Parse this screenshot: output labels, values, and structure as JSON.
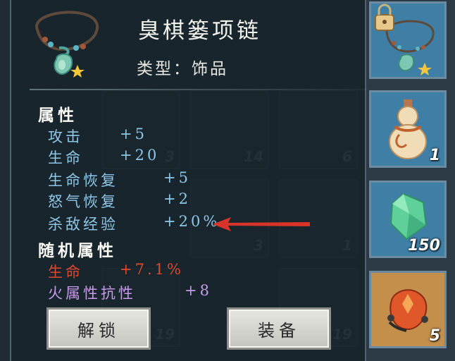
{
  "item": {
    "name": "臭棋篓项链",
    "type_label": "类型",
    "type_separator": "：",
    "type_value": "饰品"
  },
  "attributes": {
    "title": "属性",
    "stats": [
      {
        "name": "攻击",
        "value": "+5"
      },
      {
        "name": "生命",
        "value": "+20"
      },
      {
        "name": "生命恢复",
        "value": "+5"
      },
      {
        "name": "怒气恢复",
        "value": "+2"
      },
      {
        "name": "杀敌经验",
        "value": "+20%"
      }
    ]
  },
  "random_attributes": {
    "title": "随机属性",
    "stats": [
      {
        "name": "生命",
        "value": "+7.1%"
      },
      {
        "name": "火属性抗性",
        "value": "+8"
      }
    ]
  },
  "buttons": {
    "unlock": "解锁",
    "equip": "装备"
  },
  "inventory_column": [
    {
      "icon": "necklace-locked-icon",
      "count": ""
    },
    {
      "icon": "gourd-icon",
      "count": "1"
    },
    {
      "icon": "green-crystal-icon",
      "count": "150"
    },
    {
      "icon": "fire-gem-icon",
      "count": "5"
    }
  ],
  "background_counts": [
    "3",
    "14",
    "6",
    "3",
    "1",
    "19",
    "19"
  ],
  "colors": {
    "stat_blue": "#8ec6e6",
    "stat_red": "#e0472f",
    "stat_purple": "#c79be9",
    "arrow_red": "#d9342a"
  }
}
